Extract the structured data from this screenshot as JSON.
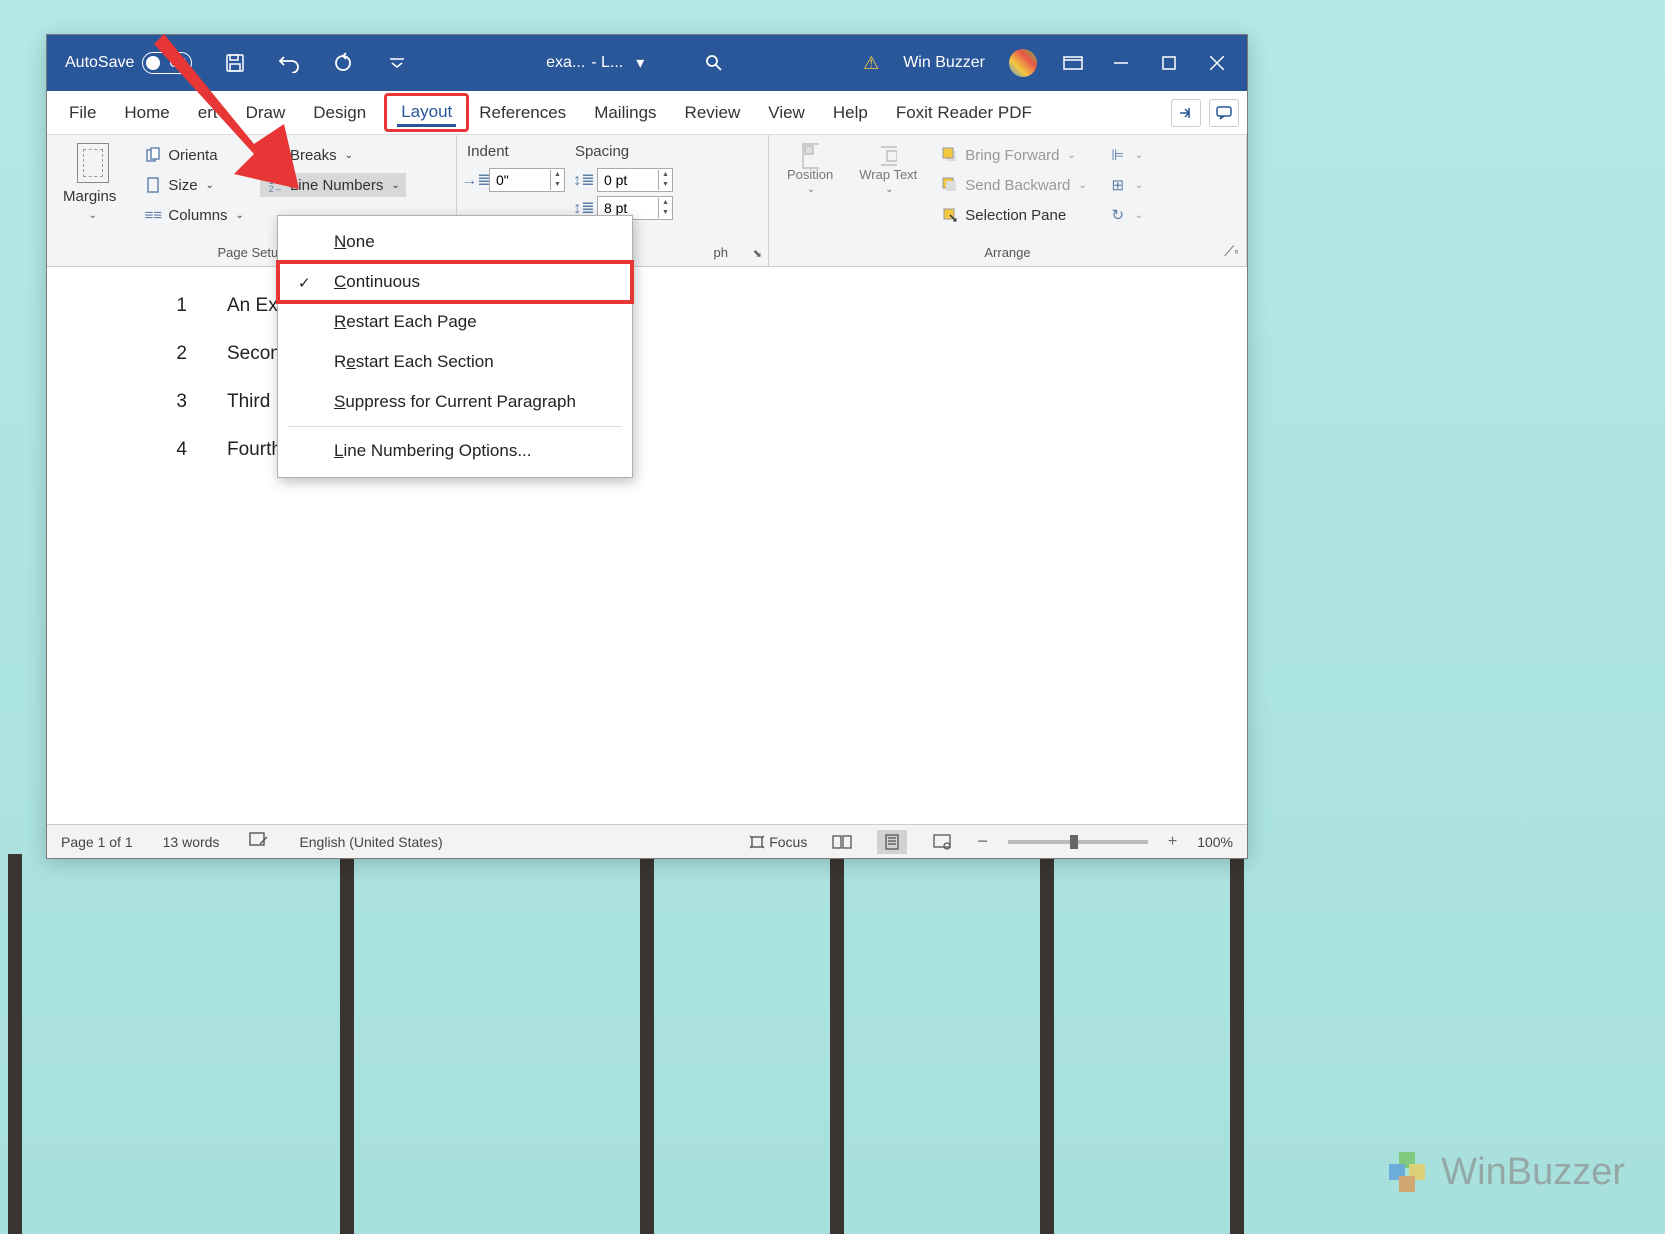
{
  "titlebar": {
    "autosave_label": "AutoSave",
    "autosave_state": "Off",
    "doc_name": "exa...",
    "doc_suffix": "- L...",
    "user_name": "Win Buzzer"
  },
  "tabs": {
    "file": "File",
    "home": "Home",
    "insert": "ert",
    "draw": "Draw",
    "design": "Design",
    "layout": "Layout",
    "references": "References",
    "mailings": "Mailings",
    "review": "Review",
    "view": "View",
    "help": "Help",
    "foxit": "Foxit Reader PDF"
  },
  "ribbon": {
    "page_setup": {
      "margins": "Margins",
      "orientation": "Orienta",
      "size": "Size",
      "columns": "Columns",
      "breaks": "Breaks",
      "line_numbers": "Line Numbers",
      "group_label": "Page Setup"
    },
    "paragraph": {
      "indent_label": "Indent",
      "spacing_label": "Spacing",
      "indent_left": "0\"",
      "before": "0 pt",
      "after": "8 pt",
      "group_label_suffix": "ph"
    },
    "arrange": {
      "position": "Position",
      "wrap_text": "Wrap Text",
      "bring_forward": "Bring Forward",
      "send_backward": "Send Backward",
      "selection_pane": "Selection Pane",
      "group_label": "Arrange"
    }
  },
  "dropdown": {
    "none": "None",
    "continuous": "Continuous",
    "restart_page": "Restart Each Page",
    "restart_section": "Restart Each Section",
    "suppress": "Suppress for Current Paragraph",
    "options": "Line Numbering Options..."
  },
  "document": {
    "lines": [
      {
        "n": "1",
        "text": "An Exa"
      },
      {
        "n": "2",
        "text": "Second"
      },
      {
        "n": "3",
        "text": "Third Li"
      },
      {
        "n": "4",
        "text": "Fourth"
      }
    ]
  },
  "statusbar": {
    "page": "Page 1 of 1",
    "words": "13 words",
    "language": "English (United States)",
    "focus": "Focus",
    "zoom": "100%"
  },
  "watermark": "WinBuzzer"
}
